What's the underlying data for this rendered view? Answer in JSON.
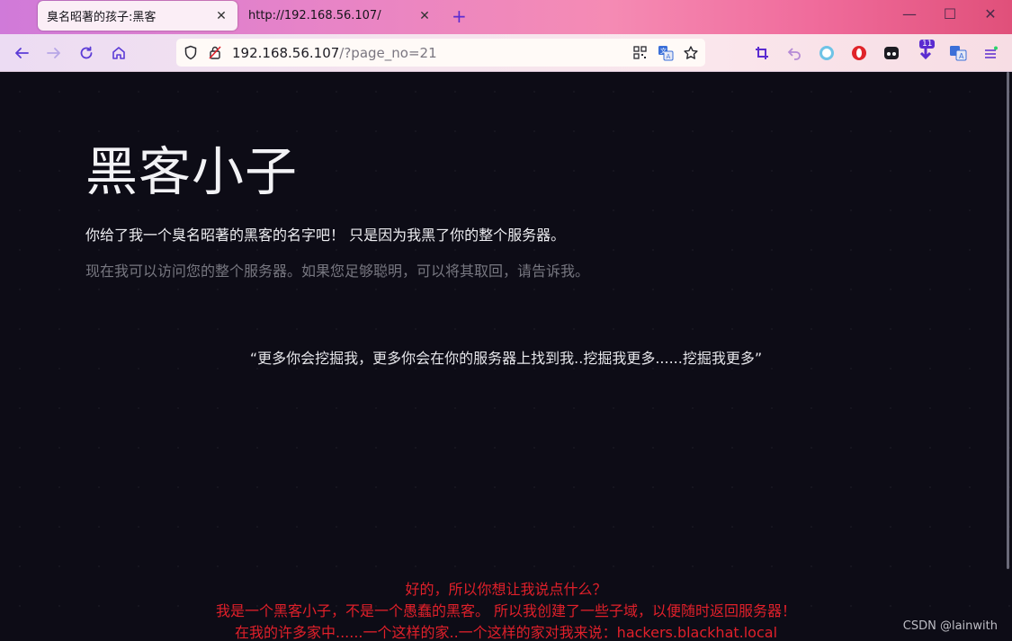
{
  "browser": {
    "tabs": [
      {
        "title": "臭名昭著的孩子:黑客",
        "active": true
      },
      {
        "title": "http://192.168.56.107/",
        "active": false
      }
    ],
    "new_tab": "+",
    "url": {
      "host": "192.168.56.107",
      "path": "/?page_no=21"
    },
    "extensions": [
      "crop-icon",
      "undo-icon",
      "circle-icon",
      "opera-icon",
      "mask-icon",
      "download-badge-icon",
      "translate-icon",
      "menu-icon"
    ],
    "download_badge": "11"
  },
  "page": {
    "heading": "黑客小子",
    "lead": "你给了我一个臭名昭著的黑客的名字吧！ 只是因为我黑了你的整个服务器。",
    "muted": "现在我可以访问您的整个服务器。如果您足够聪明，可以将其取回，请告诉我。",
    "quote": "“更多你会挖掘我，更多你会在你的服务器上找到我..挖掘我更多......挖掘我更多”",
    "message_lines": [
      "好的，所以你想让我说点什么？",
      "我是一个黑客小子，不是一个愚蠢的黑客。 所以我创建了一些子域，以便随时返回服务器！",
      "在我的许多家中......一个这样的家..一个这样的家对我来说：hackers.blackhat.local"
    ],
    "watermark": "CSDN @lainwith"
  },
  "colors": {
    "page_bg": "#0d0c16",
    "message": "#e0202a",
    "accent": "#5b2bd0"
  }
}
